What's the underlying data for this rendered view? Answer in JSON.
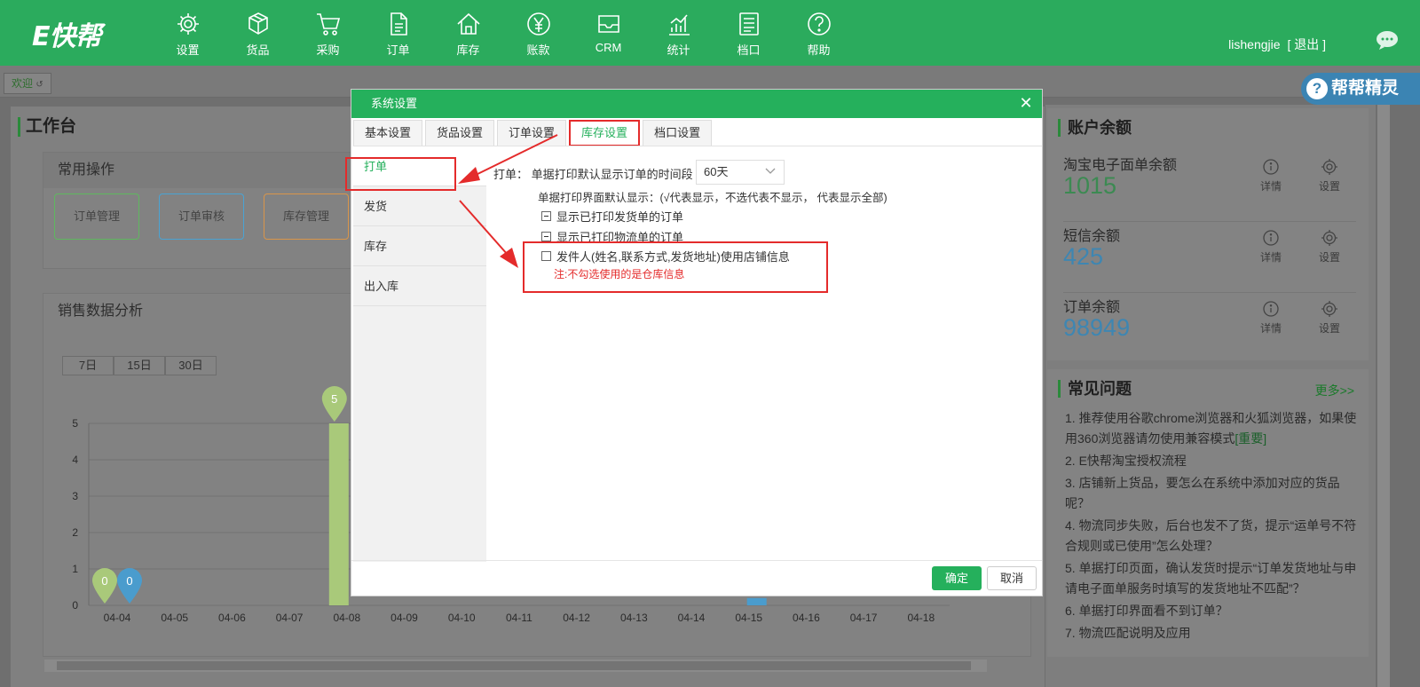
{
  "header": {
    "logo": "E快帮",
    "nav": [
      {
        "label": "设置",
        "icon": "gear-icon"
      },
      {
        "label": "货品",
        "icon": "box-icon"
      },
      {
        "label": "采购",
        "icon": "cart-icon"
      },
      {
        "label": "订单",
        "icon": "document-icon"
      },
      {
        "label": "库存",
        "icon": "home-icon"
      },
      {
        "label": "账款",
        "icon": "yen-icon"
      },
      {
        "label": "CRM",
        "icon": "inbox-icon"
      },
      {
        "label": "统计",
        "icon": "chart-icon"
      },
      {
        "label": "档口",
        "icon": "list-icon"
      },
      {
        "label": "帮助",
        "icon": "help-icon"
      }
    ],
    "user": "lishengjie",
    "logout": "[ 退出 ]"
  },
  "tabs": {
    "welcome": "欢迎"
  },
  "helper": {
    "icon": "question-icon",
    "label": "帮帮精灵"
  },
  "workbench": {
    "title": "工作台",
    "common_ops": {
      "title": "常用操作",
      "buttons": [
        "订单管理",
        "订单审核",
        "库存管理"
      ]
    },
    "sales": {
      "title": "销售数据分析",
      "ranges": [
        "7日",
        "15日",
        "30日"
      ]
    }
  },
  "chart_data": {
    "type": "bar",
    "categories": [
      "04-04",
      "04-05",
      "04-06",
      "04-07",
      "04-08",
      "04-09",
      "04-10",
      "04-11",
      "04-12",
      "04-13",
      "04-14",
      "04-15",
      "04-16",
      "04-17",
      "04-18"
    ],
    "series": [
      {
        "values": [
          0,
          0,
          0,
          0,
          5,
          0,
          0,
          0,
          0,
          0,
          0,
          0,
          0,
          0,
          0
        ],
        "color": "#a9c97a"
      },
      {
        "values": [
          0,
          0,
          0,
          0,
          0,
          0,
          0,
          0,
          0,
          0,
          0,
          0.2,
          0,
          0,
          0
        ],
        "color": "#4a9ccd"
      }
    ],
    "yticks": [
      0,
      1,
      2,
      3,
      4,
      5
    ],
    "ylim": [
      0,
      5
    ],
    "markers": [
      {
        "category": "04-04",
        "series": 0,
        "label": "0"
      },
      {
        "category": "04-04",
        "series": 1,
        "label": "0"
      },
      {
        "category": "04-08",
        "series": 0,
        "label": "5"
      }
    ]
  },
  "account": {
    "title": "账户余额",
    "items": [
      {
        "label": "淘宝电子面单余额",
        "value": "1015",
        "color": "#4fb36c"
      },
      {
        "label": "短信余额",
        "value": "425",
        "color": "#5aaedc"
      },
      {
        "label": "订单余额",
        "value": "98949",
        "color": "#5aaedc"
      }
    ],
    "detail_label": "详情",
    "settings_label": "设置"
  },
  "faq": {
    "title": "常见问题",
    "more": "更多>>",
    "items": [
      {
        "text": "1. 推荐使用谷歌chrome浏览器和火狐浏览器，如果使用360浏览器请勿使用兼容模式",
        "tag": "[重要]"
      },
      {
        "text": "2. E快帮淘宝授权流程",
        "tag": ""
      },
      {
        "text": "3. 店铺新上货品，要怎么在系统中添加对应的货品呢？",
        "tag": ""
      },
      {
        "text": "4. 物流同步失败，后台也发不了货，提示“运单号不符合规则或已使用”怎么处理？",
        "tag": ""
      },
      {
        "text": "5. 单据打印页面，确认发货时提示“订单发货地址与申请电子面单服务时填写的发货地址不匹配”？",
        "tag": ""
      },
      {
        "text": "6. 单据打印界面看不到订单？",
        "tag": ""
      },
      {
        "text": "7. 物流匹配说明及应用",
        "tag": ""
      }
    ]
  },
  "modal": {
    "title": "系统设置",
    "tabs": [
      "基本设置",
      "货品设置",
      "订单设置",
      "库存设置",
      "档口设置"
    ],
    "active_tab": 3,
    "side": [
      "打单",
      "发货",
      "库存",
      "出入库"
    ],
    "active_side": 0,
    "row_label": "打单：  单据打印默认显示订单的时间段",
    "period": "60天",
    "hint": "单据打印界面默认显示：(√代表显示，不选代表不显示， 代表显示全部)",
    "options": [
      {
        "label": "显示已打印发货单的订单",
        "state": "indeterminate"
      },
      {
        "label": "显示已打印物流单的订单",
        "state": "indeterminate"
      },
      {
        "label": "发件人(姓名,联系方式,发货地址)使用店铺信息",
        "state": "unchecked"
      }
    ],
    "note": "注:不勾选使用的是仓库信息",
    "ok": "确定",
    "cancel": "取消"
  }
}
